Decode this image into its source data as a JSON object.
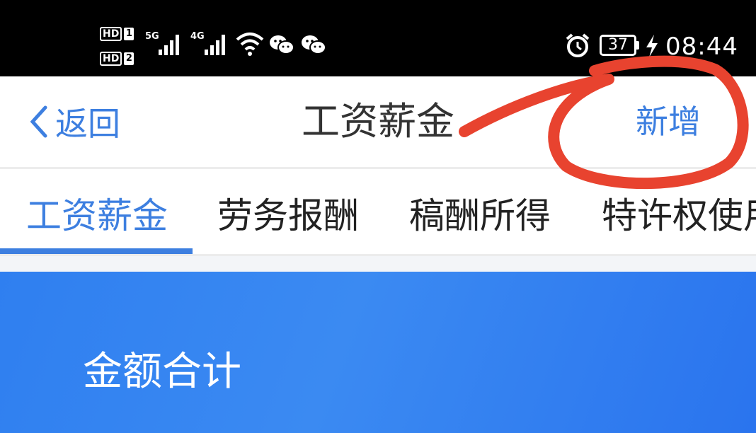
{
  "status_bar": {
    "sim1": {
      "badge": "HD",
      "slot": "1"
    },
    "sim2": {
      "badge": "HD",
      "slot": "2"
    },
    "network1": "5G",
    "network2": "4G",
    "battery": "37",
    "time": "08:44",
    "icons": [
      "signal-icon",
      "signal-icon",
      "wifi-icon",
      "wechat-icon",
      "wechat-icon",
      "alarm-icon",
      "battery-icon",
      "charging-icon"
    ]
  },
  "nav": {
    "back_label": "返回",
    "title": "工资薪金",
    "add_label": "新增"
  },
  "tabs": [
    {
      "label": "工资薪金",
      "active": true
    },
    {
      "label": "劳务报酬",
      "active": false
    },
    {
      "label": "稿酬所得",
      "active": false
    },
    {
      "label": "特许权使用",
      "active": false
    }
  ],
  "summary": {
    "label": "金额合计"
  },
  "colors": {
    "accent": "#3d7fe0",
    "card_blue": "#2f7ff0",
    "annotation_red": "#e8432f"
  }
}
